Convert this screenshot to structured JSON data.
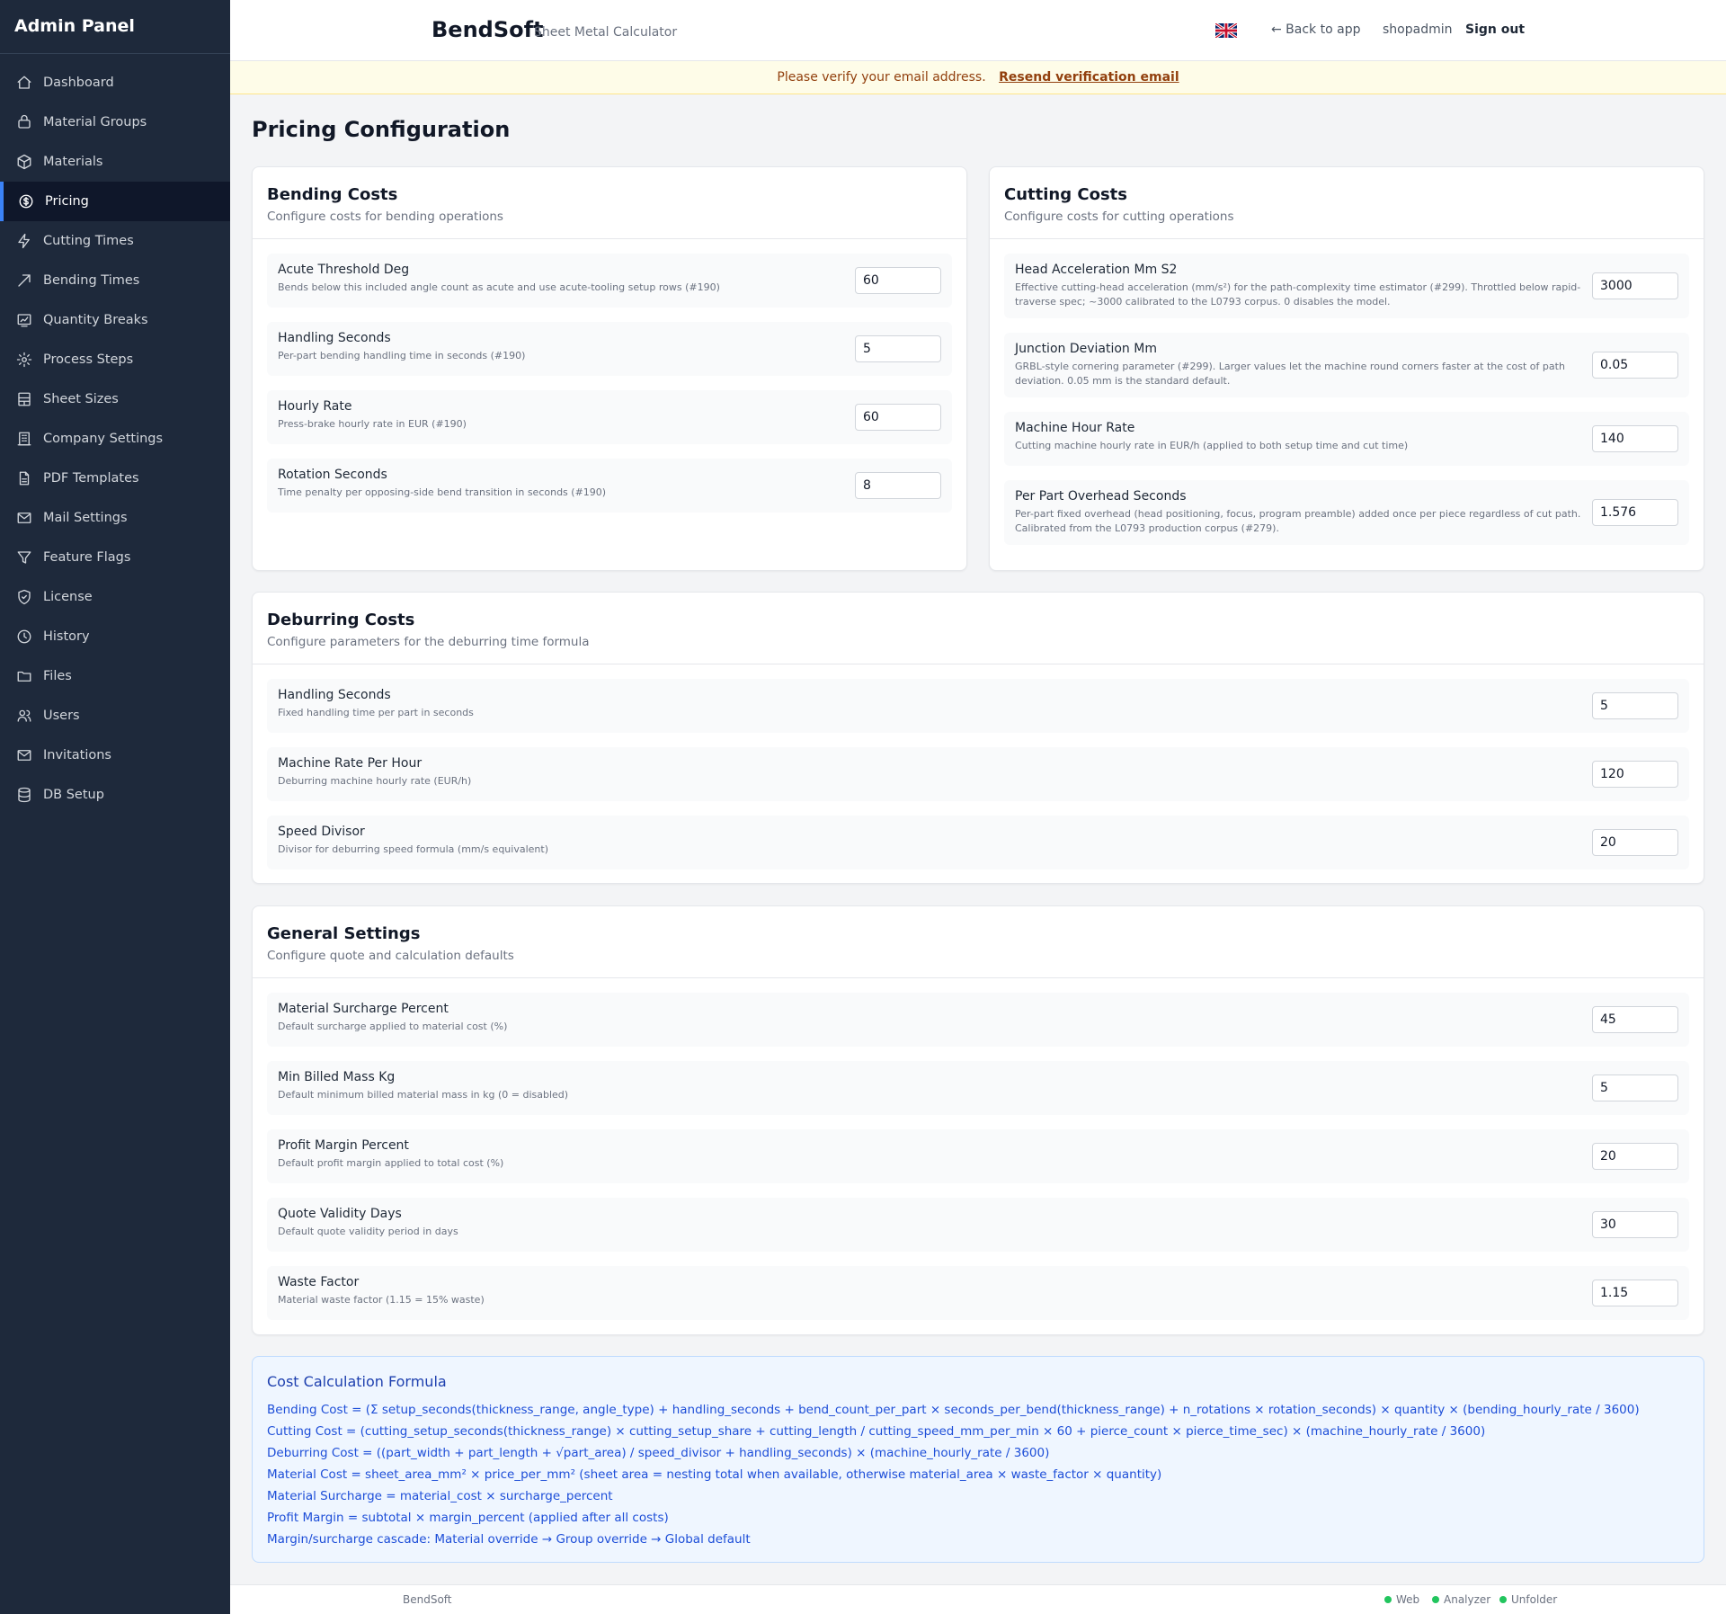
{
  "sidebar": {
    "title": "Admin Panel",
    "items": [
      {
        "label": "Dashboard",
        "icon": "home-icon"
      },
      {
        "label": "Material Groups",
        "icon": "layers-icon"
      },
      {
        "label": "Materials",
        "icon": "box-icon"
      },
      {
        "label": "Pricing",
        "icon": "dollar-icon",
        "active": true
      },
      {
        "label": "Cutting Times",
        "icon": "bolt-icon"
      },
      {
        "label": "Bending Times",
        "icon": "trend-icon"
      },
      {
        "label": "Quantity Breaks",
        "icon": "chart-icon"
      },
      {
        "label": "Process Steps",
        "icon": "gear-icon"
      },
      {
        "label": "Sheet Sizes",
        "icon": "grid-icon"
      },
      {
        "label": "Company Settings",
        "icon": "building-icon"
      },
      {
        "label": "PDF Templates",
        "icon": "file-icon"
      },
      {
        "label": "Mail Settings",
        "icon": "mail-icon"
      },
      {
        "label": "Feature Flags",
        "icon": "filter-icon"
      },
      {
        "label": "License",
        "icon": "shield-icon"
      },
      {
        "label": "History",
        "icon": "clock-icon"
      },
      {
        "label": "Files",
        "icon": "folder-icon"
      },
      {
        "label": "Users",
        "icon": "users-icon"
      },
      {
        "label": "Invitations",
        "icon": "mail-icon"
      },
      {
        "label": "DB Setup",
        "icon": "database-icon"
      }
    ]
  },
  "topbar": {
    "brand": "BendSoft",
    "subtitle": "Sheet Metal Calculator",
    "back": "← Back to app",
    "user": "shopadmin",
    "signout": "Sign out"
  },
  "banner": {
    "text": "Please verify your email address.",
    "link": "Resend verification email"
  },
  "page": {
    "title": "Pricing Configuration"
  },
  "bending": {
    "title": "Bending Costs",
    "desc": "Configure costs for bending operations",
    "rows": [
      {
        "label": "Acute Threshold Deg",
        "help": "Bends below this included angle count as acute and use acute-tooling setup rows (#190)",
        "value": "60"
      },
      {
        "label": "Handling Seconds",
        "help": "Per-part bending handling time in seconds (#190)",
        "value": "5"
      },
      {
        "label": "Hourly Rate",
        "help": "Press-brake hourly rate in EUR (#190)",
        "value": "60"
      },
      {
        "label": "Rotation Seconds",
        "help": "Time penalty per opposing-side bend transition in seconds (#190)",
        "value": "8"
      }
    ]
  },
  "cutting": {
    "title": "Cutting Costs",
    "desc": "Configure costs for cutting operations",
    "rows": [
      {
        "label": "Head Acceleration Mm S2",
        "help": "Effective cutting-head acceleration (mm/s²) for the path-complexity time estimator (#299). Throttled below rapid-traverse spec; ~3000 calibrated to the L0793 corpus. 0 disables the model.",
        "value": "3000"
      },
      {
        "label": "Junction Deviation Mm",
        "help": "GRBL-style cornering parameter (#299). Larger values let the machine round corners faster at the cost of path deviation. 0.05 mm is the standard default.",
        "value": "0.05"
      },
      {
        "label": "Machine Hour Rate",
        "help": "Cutting machine hourly rate in EUR/h (applied to both setup time and cut time)",
        "value": "140"
      },
      {
        "label": "Per Part Overhead Seconds",
        "help": "Per-part fixed overhead (head positioning, focus, program preamble) added once per piece regardless of cut path. Calibrated from the L0793 production corpus (#279).",
        "value": "1.576"
      }
    ]
  },
  "deburring": {
    "title": "Deburring Costs",
    "desc": "Configure parameters for the deburring time formula",
    "rows": [
      {
        "label": "Handling Seconds",
        "help": "Fixed handling time per part in seconds",
        "value": "5"
      },
      {
        "label": "Machine Rate Per Hour",
        "help": "Deburring machine hourly rate (EUR/h)",
        "value": "120"
      },
      {
        "label": "Speed Divisor",
        "help": "Divisor for deburring speed formula (mm/s equivalent)",
        "value": "20"
      }
    ]
  },
  "general": {
    "title": "General Settings",
    "desc": "Configure quote and calculation defaults",
    "rows": [
      {
        "label": "Material Surcharge Percent",
        "help": "Default surcharge applied to material cost (%)",
        "value": "45"
      },
      {
        "label": "Min Billed Mass Kg",
        "help": "Default minimum billed material mass in kg (0 = disabled)",
        "value": "5"
      },
      {
        "label": "Profit Margin Percent",
        "help": "Default profit margin applied to total cost (%)",
        "value": "20"
      },
      {
        "label": "Quote Validity Days",
        "help": "Default quote validity period in days",
        "value": "30"
      },
      {
        "label": "Waste Factor",
        "help": "Material waste factor (1.15 = 15% waste)",
        "value": "1.15"
      }
    ]
  },
  "formula": {
    "title": "Cost Calculation Formula",
    "lines": [
      "Bending Cost = (Σ setup_seconds(thickness_range, angle_type) + handling_seconds + bend_count_per_part × seconds_per_bend(thickness_range) + n_rotations × rotation_seconds) × quantity × (bending_hourly_rate / 3600)",
      "Cutting Cost = (cutting_setup_seconds(thickness_range) × cutting_setup_share + cutting_length / cutting_speed_mm_per_min × 60 + pierce_count × pierce_time_sec) × (machine_hourly_rate / 3600)",
      "Deburring Cost = ((part_width + part_length + √part_area) / speed_divisor + handling_seconds) × (machine_hourly_rate / 3600)",
      "Material Cost = sheet_area_mm² × price_per_mm² (sheet area = nesting total when available, otherwise material_area × waste_factor × quantity)",
      "Material Surcharge = material_cost × surcharge_percent",
      "Profit Margin = subtotal × margin_percent (applied after all costs)",
      "Margin/surcharge cascade: Material override → Group override → Global default"
    ]
  },
  "footer": {
    "brand": "BendSoft",
    "services": [
      "Web",
      "Analyzer",
      "Unfolder"
    ],
    "status_color": "#22c55e"
  }
}
